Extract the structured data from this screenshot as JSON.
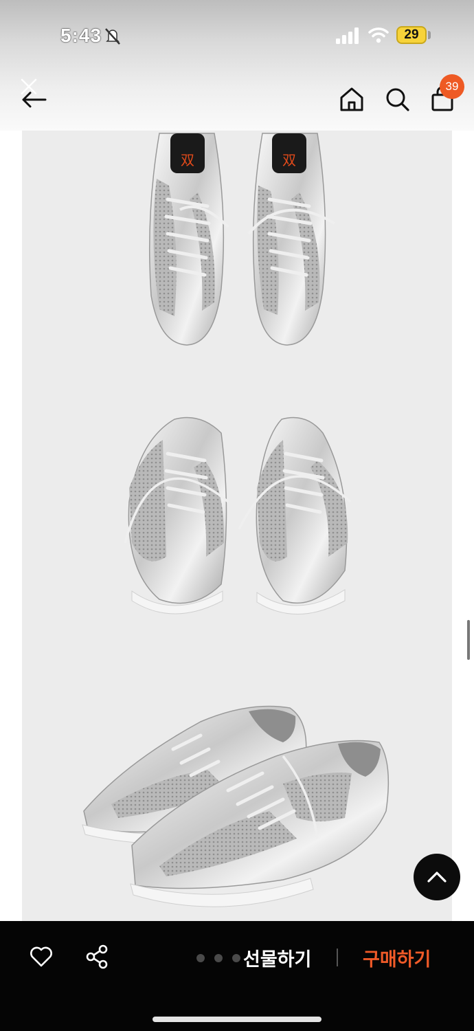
{
  "status_bar": {
    "time": "5:43",
    "battery": "29",
    "icons": [
      "bell-off-icon",
      "signal-icon",
      "wifi-icon",
      "battery-icon"
    ]
  },
  "header": {
    "back_icon": "back-arrow-icon",
    "icons": [
      "home-icon",
      "search-icon",
      "shopping-bag-icon"
    ],
    "cart_count": "39"
  },
  "product_images": [
    {
      "view": "top-down pair",
      "color": "silver"
    },
    {
      "view": "front pair",
      "color": "silver"
    },
    {
      "view": "side angle pair",
      "color": "silver"
    }
  ],
  "bottom_bar": {
    "icons": [
      "heart-icon",
      "share-icon"
    ],
    "gift_label": "선물하기",
    "buy_label": "구매하기"
  },
  "colors": {
    "accent": "#f05a28",
    "badge": "#ee5a24",
    "bottom_bar": "#050505",
    "image_bg": "#ececec"
  }
}
